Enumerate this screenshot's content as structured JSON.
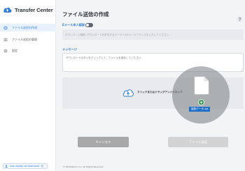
{
  "app": {
    "name": "Transfer Center",
    "brand_color": "#2f7fd8"
  },
  "sidebar": {
    "items": [
      {
        "label": "ファイル送信の作成",
        "icon": "link-icon",
        "active": true
      },
      {
        "label": "ファイル送信の管理",
        "icon": "list-icon",
        "active": false
      },
      {
        "label": "設定",
        "icon": "gear-icon",
        "active": false
      }
    ],
    "user": {
      "label": "user-assign.wt.download",
      "icon": "user-icon",
      "external_icon": "external-link-icon"
    }
  },
  "main": {
    "title": "ファイル送信の作成",
    "email": {
      "label": "Eメール本人認証",
      "toggle_on": false,
      "placeholder": "ダウンロード権限: ダウンロードを許可するユーザーのEメールアドレスを入力してください。"
    },
    "message": {
      "label": "メッセージ",
      "value": "ダウンロードボタンをクリックして、ファイルを保存してください。"
    },
    "dropzone": {
      "text": "クリックまたはドラッグアンドドロップ",
      "dragging_file": "複数データ.zip"
    },
    "buttons": {
      "cancel": "キャンセル",
      "send": "ファイル送信"
    }
  },
  "footer": {
    "copyright": "© WhitePoint, Inc. All Rights Reserved"
  },
  "colors": {
    "accent": "#2f7fd8",
    "cancel_button": "#a8a8a8",
    "send_button_disabled": "#d3d3d3",
    "badge_green": "#2e9e4a"
  }
}
